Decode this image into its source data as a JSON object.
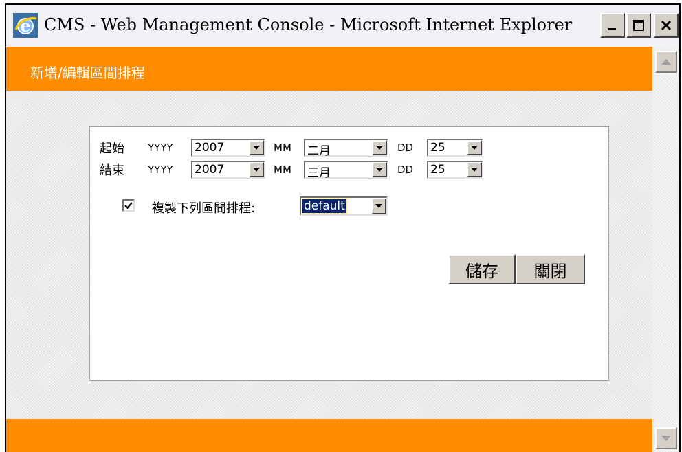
{
  "window": {
    "title": "CMS - Web Management Console - Microsoft Internet Explorer",
    "controls": {
      "minimize": "_",
      "maximize": "□",
      "close": "✕"
    }
  },
  "header": {
    "title": "新增/編輯區間排程"
  },
  "form": {
    "start": {
      "label": "起始",
      "yyyy_label": "YYYY",
      "year": "2007",
      "mm_label": "MM",
      "month": "二月",
      "dd_label": "DD",
      "day": "25"
    },
    "end": {
      "label": "結束",
      "yyyy_label": "YYYY",
      "year": "2007",
      "mm_label": "MM",
      "month": "三月",
      "dd_label": "DD",
      "day": "25"
    },
    "copy": {
      "checked": true,
      "label": "複製下列區間排程:",
      "selected": "default"
    }
  },
  "buttons": {
    "save": "儲存",
    "close": "關閉"
  },
  "colors": {
    "header": "#ff8c00",
    "selection": "#0a246a"
  }
}
